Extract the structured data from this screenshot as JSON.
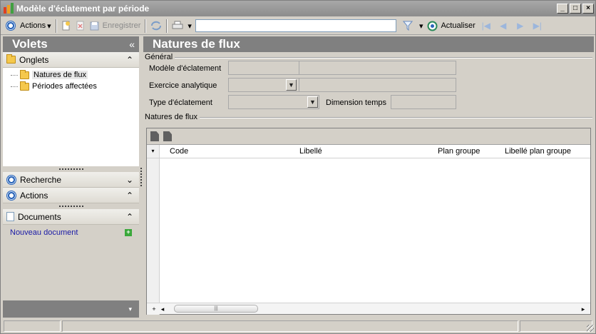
{
  "window": {
    "title": "Modèle d'éclatement par période",
    "min_glyph": "_",
    "max_glyph": "□",
    "close_glyph": "×"
  },
  "toolbar": {
    "actions_label": "Actions",
    "actions_caret": "▾",
    "save_label": "Enregistrer",
    "search_value": "",
    "refresh_label": "Actualiser",
    "filter_caret": "▾",
    "print_caret": "▾"
  },
  "left_panel": {
    "header": "Volets",
    "header_chevron": "«",
    "tabs_section": {
      "title": "Onglets",
      "chevron": "⌃",
      "items": [
        {
          "label": "Natures de flux",
          "selected": true
        },
        {
          "label": "Périodes affectées",
          "selected": false
        }
      ]
    },
    "search_section": {
      "title": "Recherche",
      "chevron": "⌄"
    },
    "actions_section": {
      "title": "Actions",
      "chevron": "⌃"
    },
    "documents_section": {
      "title": "Documents",
      "chevron": "⌃",
      "new_link": "Nouveau document",
      "plus_glyph": "+"
    },
    "bottom_chevron": "▾"
  },
  "main": {
    "title": "Natures de flux",
    "general_group": "Général",
    "fields": {
      "model_label": "Modèle d'éclatement",
      "exercise_label": "Exercice analytique",
      "type_label": "Type d'éclatement",
      "dimension_label": "Dimension temps"
    },
    "flux_group": "Natures de flux",
    "grid": {
      "columns": [
        "Code",
        "Libellé",
        "Plan groupe",
        "Libellé plan groupe"
      ],
      "rows": [],
      "row_indicator_glyph": "▾",
      "add_row_glyph": "+",
      "scroll_left": "◂",
      "scroll_right": "▸",
      "thumb_grip": "|||"
    }
  },
  "colors": {
    "title_bar": "#8c8c8c",
    "panel_header": "#808080",
    "accent_blue": "#2a64b8",
    "link": "#1a1aa6"
  }
}
